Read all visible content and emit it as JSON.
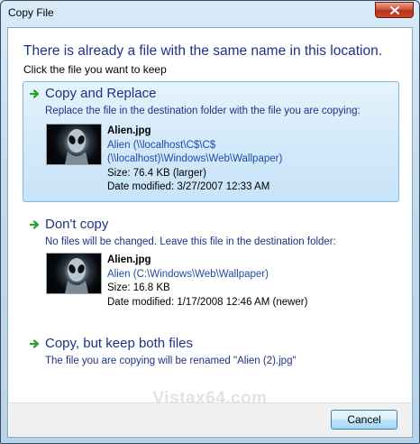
{
  "window": {
    "title": "Copy File"
  },
  "heading": "There is already a file with the same name in this location.",
  "subheading": "Click the file you want to keep",
  "options": [
    {
      "title": "Copy and Replace",
      "description": "Replace the file in the destination folder with the file you are copying:",
      "file": {
        "name": "Alien.jpg",
        "folder_line1": "Alien (\\\\localhost\\C$\\C$",
        "folder_line2": "(\\\\localhost)\\Windows\\Web\\Wallpaper)",
        "size": "Size: 76.4 KB (larger)",
        "date_modified": "Date modified: 3/27/2007 12:33 AM"
      }
    },
    {
      "title": "Don't copy",
      "description": "No files will be changed. Leave this file in the destination folder:",
      "file": {
        "name": "Alien.jpg",
        "folder_line1": "Alien (C:\\Windows\\Web\\Wallpaper)",
        "size": "Size: 16.8 KB",
        "date_modified": "Date modified: 1/17/2008 12:46 AM (newer)"
      }
    },
    {
      "title": "Copy, but keep both files",
      "description": "The file you are copying will be renamed \"Alien (2).jpg\""
    }
  ],
  "watermark": "Vistax64.com",
  "buttons": {
    "cancel": "Cancel"
  },
  "icons": {
    "close": "close-icon",
    "option_arrow": "green-arrow-icon",
    "thumbnail": "alien-image-thumbnail"
  },
  "colors": {
    "link_blue": "#1e3287",
    "selected_bg": "#d4eafa",
    "arrow_green": "#2f9e2f",
    "close_red": "#c9472e"
  }
}
